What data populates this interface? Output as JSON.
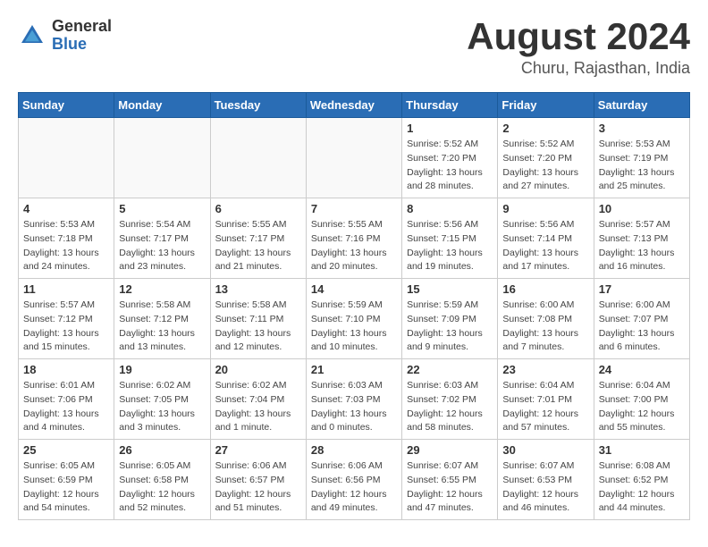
{
  "logo": {
    "general": "General",
    "blue": "Blue"
  },
  "header": {
    "month": "August 2024",
    "location": "Churu, Rajasthan, India"
  },
  "weekdays": [
    "Sunday",
    "Monday",
    "Tuesday",
    "Wednesday",
    "Thursday",
    "Friday",
    "Saturday"
  ],
  "weeks": [
    [
      {
        "day": "",
        "info": ""
      },
      {
        "day": "",
        "info": ""
      },
      {
        "day": "",
        "info": ""
      },
      {
        "day": "",
        "info": ""
      },
      {
        "day": "1",
        "info": "Sunrise: 5:52 AM\nSunset: 7:20 PM\nDaylight: 13 hours\nand 28 minutes."
      },
      {
        "day": "2",
        "info": "Sunrise: 5:52 AM\nSunset: 7:20 PM\nDaylight: 13 hours\nand 27 minutes."
      },
      {
        "day": "3",
        "info": "Sunrise: 5:53 AM\nSunset: 7:19 PM\nDaylight: 13 hours\nand 25 minutes."
      }
    ],
    [
      {
        "day": "4",
        "info": "Sunrise: 5:53 AM\nSunset: 7:18 PM\nDaylight: 13 hours\nand 24 minutes."
      },
      {
        "day": "5",
        "info": "Sunrise: 5:54 AM\nSunset: 7:17 PM\nDaylight: 13 hours\nand 23 minutes."
      },
      {
        "day": "6",
        "info": "Sunrise: 5:55 AM\nSunset: 7:17 PM\nDaylight: 13 hours\nand 21 minutes."
      },
      {
        "day": "7",
        "info": "Sunrise: 5:55 AM\nSunset: 7:16 PM\nDaylight: 13 hours\nand 20 minutes."
      },
      {
        "day": "8",
        "info": "Sunrise: 5:56 AM\nSunset: 7:15 PM\nDaylight: 13 hours\nand 19 minutes."
      },
      {
        "day": "9",
        "info": "Sunrise: 5:56 AM\nSunset: 7:14 PM\nDaylight: 13 hours\nand 17 minutes."
      },
      {
        "day": "10",
        "info": "Sunrise: 5:57 AM\nSunset: 7:13 PM\nDaylight: 13 hours\nand 16 minutes."
      }
    ],
    [
      {
        "day": "11",
        "info": "Sunrise: 5:57 AM\nSunset: 7:12 PM\nDaylight: 13 hours\nand 15 minutes."
      },
      {
        "day": "12",
        "info": "Sunrise: 5:58 AM\nSunset: 7:12 PM\nDaylight: 13 hours\nand 13 minutes."
      },
      {
        "day": "13",
        "info": "Sunrise: 5:58 AM\nSunset: 7:11 PM\nDaylight: 13 hours\nand 12 minutes."
      },
      {
        "day": "14",
        "info": "Sunrise: 5:59 AM\nSunset: 7:10 PM\nDaylight: 13 hours\nand 10 minutes."
      },
      {
        "day": "15",
        "info": "Sunrise: 5:59 AM\nSunset: 7:09 PM\nDaylight: 13 hours\nand 9 minutes."
      },
      {
        "day": "16",
        "info": "Sunrise: 6:00 AM\nSunset: 7:08 PM\nDaylight: 13 hours\nand 7 minutes."
      },
      {
        "day": "17",
        "info": "Sunrise: 6:00 AM\nSunset: 7:07 PM\nDaylight: 13 hours\nand 6 minutes."
      }
    ],
    [
      {
        "day": "18",
        "info": "Sunrise: 6:01 AM\nSunset: 7:06 PM\nDaylight: 13 hours\nand 4 minutes."
      },
      {
        "day": "19",
        "info": "Sunrise: 6:02 AM\nSunset: 7:05 PM\nDaylight: 13 hours\nand 3 minutes."
      },
      {
        "day": "20",
        "info": "Sunrise: 6:02 AM\nSunset: 7:04 PM\nDaylight: 13 hours\nand 1 minute."
      },
      {
        "day": "21",
        "info": "Sunrise: 6:03 AM\nSunset: 7:03 PM\nDaylight: 13 hours\nand 0 minutes."
      },
      {
        "day": "22",
        "info": "Sunrise: 6:03 AM\nSunset: 7:02 PM\nDaylight: 12 hours\nand 58 minutes."
      },
      {
        "day": "23",
        "info": "Sunrise: 6:04 AM\nSunset: 7:01 PM\nDaylight: 12 hours\nand 57 minutes."
      },
      {
        "day": "24",
        "info": "Sunrise: 6:04 AM\nSunset: 7:00 PM\nDaylight: 12 hours\nand 55 minutes."
      }
    ],
    [
      {
        "day": "25",
        "info": "Sunrise: 6:05 AM\nSunset: 6:59 PM\nDaylight: 12 hours\nand 54 minutes."
      },
      {
        "day": "26",
        "info": "Sunrise: 6:05 AM\nSunset: 6:58 PM\nDaylight: 12 hours\nand 52 minutes."
      },
      {
        "day": "27",
        "info": "Sunrise: 6:06 AM\nSunset: 6:57 PM\nDaylight: 12 hours\nand 51 minutes."
      },
      {
        "day": "28",
        "info": "Sunrise: 6:06 AM\nSunset: 6:56 PM\nDaylight: 12 hours\nand 49 minutes."
      },
      {
        "day": "29",
        "info": "Sunrise: 6:07 AM\nSunset: 6:55 PM\nDaylight: 12 hours\nand 47 minutes."
      },
      {
        "day": "30",
        "info": "Sunrise: 6:07 AM\nSunset: 6:53 PM\nDaylight: 12 hours\nand 46 minutes."
      },
      {
        "day": "31",
        "info": "Sunrise: 6:08 AM\nSunset: 6:52 PM\nDaylight: 12 hours\nand 44 minutes."
      }
    ]
  ]
}
